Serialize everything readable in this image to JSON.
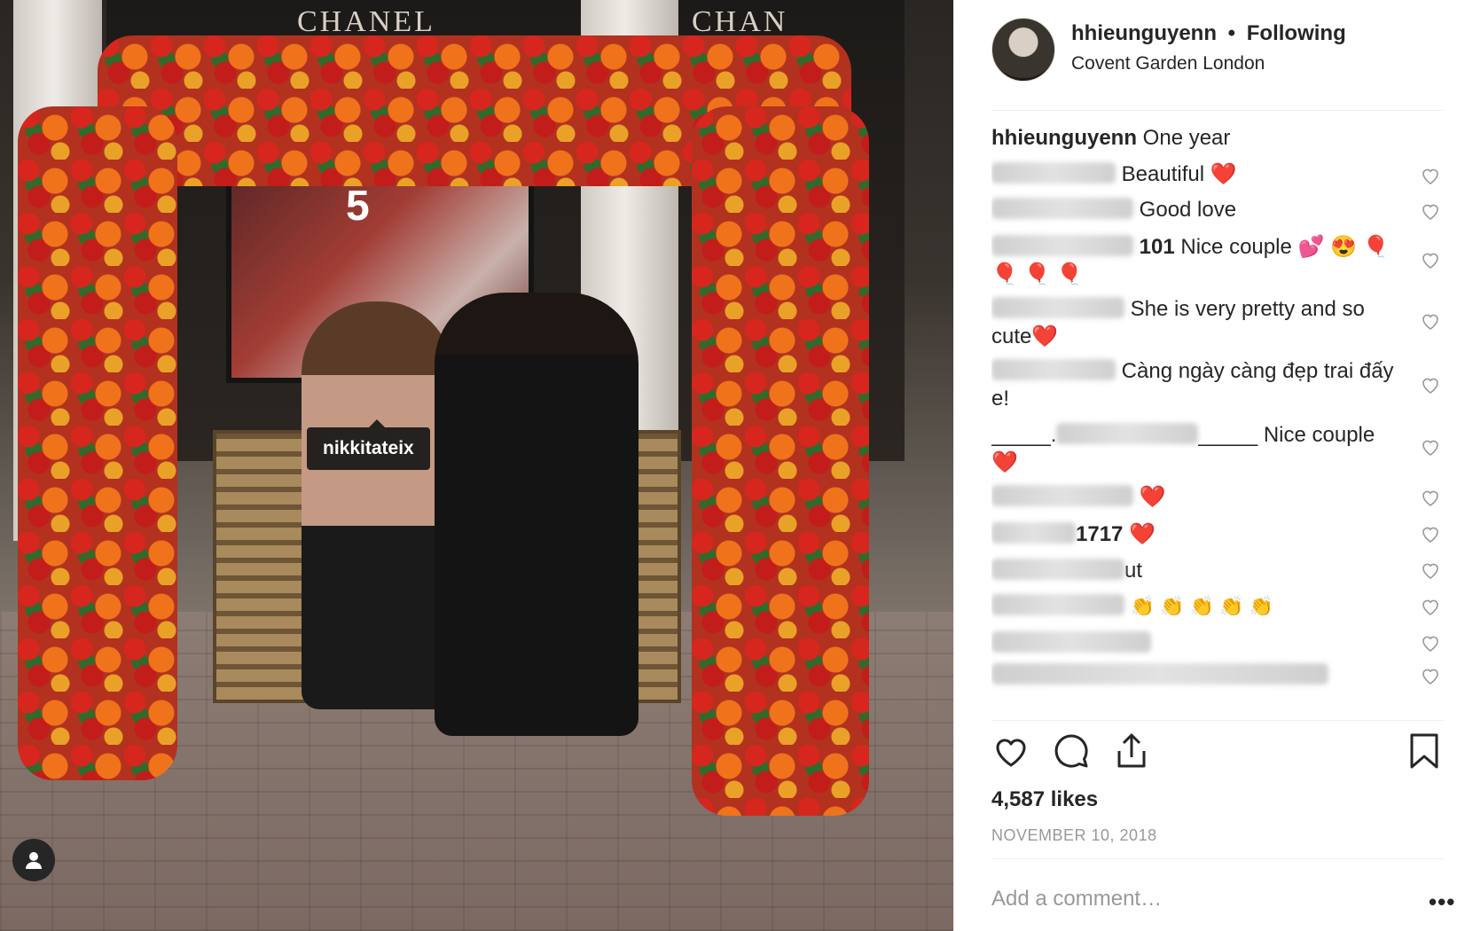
{
  "photo": {
    "sign_left": "CHANEL",
    "sign_right": "CHAN",
    "window_number": "5",
    "tag_label": "nikkitateix"
  },
  "post_header": {
    "username": "hhieunguyenn",
    "separator": "•",
    "follow_state": "Following",
    "location": "Covent Garden London"
  },
  "caption": {
    "username": "hhieunguyenn",
    "text": "One year"
  },
  "comments": [
    {
      "prefix": "",
      "text": "Beautiful",
      "emoji": "❤️"
    },
    {
      "prefix": "",
      "text": "Good love",
      "emoji": ""
    },
    {
      "prefix": "101",
      "text": " Nice couple 💕 😍 🎈",
      "emoji": "🎈 🎈 🎈"
    },
    {
      "prefix": "",
      "text": "She is very pretty and so cute",
      "emoji": "❤️"
    },
    {
      "prefix": "",
      "text": "Càng ngày càng đẹp trai đấy e!",
      "emoji": ""
    },
    {
      "prefix": "_____.",
      "text": "_____ Nice couple",
      "emoji": "❤️"
    },
    {
      "prefix": "",
      "text": "",
      "emoji": "❤️"
    },
    {
      "prefix": "1717",
      "text": "",
      "emoji": "❤️"
    },
    {
      "prefix": "",
      "text": "ut",
      "emoji": ""
    },
    {
      "prefix": "",
      "text": "",
      "emoji": "👏 👏 👏 👏 👏"
    },
    {
      "prefix": "",
      "text": "",
      "emoji": ""
    },
    {
      "prefix": "",
      "text": "",
      "emoji": ""
    }
  ],
  "actions": {
    "like_icon": "heart-outline",
    "comment_icon": "speech-bubble",
    "share_icon": "share-upload",
    "save_icon": "bookmark"
  },
  "likes": "4,587 likes",
  "date": "NOVEMBER 10, 2018",
  "add_comment_placeholder": "Add a comment…",
  "more_options": "•••",
  "colors": {
    "text": "#262626",
    "muted": "#999999",
    "heart": "#ed1c3a",
    "divider": "#efefef"
  }
}
